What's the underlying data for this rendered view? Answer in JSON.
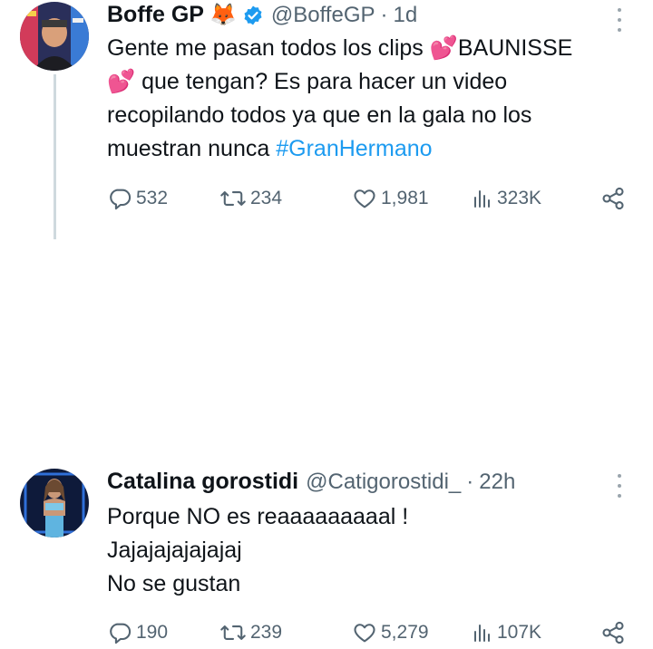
{
  "tweets": [
    {
      "author_name": "Boffe GP",
      "author_emoji": "🦊",
      "handle": "@BoffeGP",
      "separator": "·",
      "time": "1d",
      "verified": true,
      "text_lines": [
        "Gente me pasan todos los clips 💕BAUNISSE",
        "💕 que tengan? Es para hacer un video",
        "recopilando todos ya que en la gala no los",
        "muestran nunca"
      ],
      "hashtag": "#GranHermano",
      "stats": {
        "replies": "532",
        "retweets": "234",
        "likes": "1,981",
        "views": "323K"
      }
    },
    {
      "author_name": "Catalina gorostidi",
      "handle": "@Catigorostidi_",
      "separator": "·",
      "time": "22h",
      "text_lines": [
        "Porque NO es reaaaaaaaaal !",
        "Jajajajajajajaj",
        "No se gustan"
      ],
      "stats": {
        "replies": "190",
        "retweets": "239",
        "likes": "5,279",
        "views": "107K"
      }
    }
  ],
  "colors": {
    "text": "#0f1419",
    "muted": "#536471",
    "link": "#1d9bf0",
    "verified": "#1d9bf0",
    "thread_line": "#cfd9de"
  },
  "icons": [
    "reply-icon",
    "retweet-icon",
    "like-icon",
    "views-icon",
    "share-icon",
    "more-icon",
    "verified-badge-icon"
  ]
}
